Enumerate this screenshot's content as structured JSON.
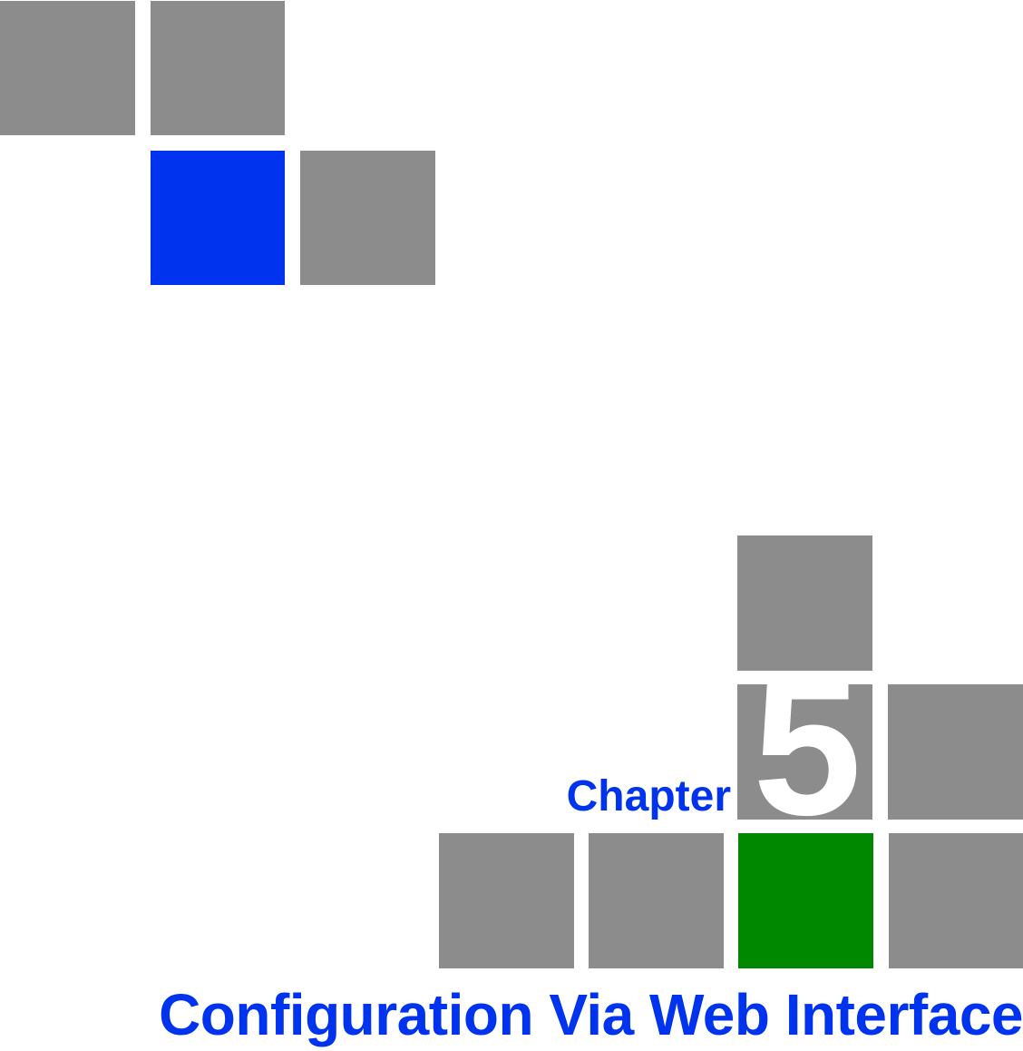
{
  "colors": {
    "block_grey": "#8c8c8c",
    "accent_blue": "#0033ee",
    "accent_green": "#008800",
    "background": "#ffffff"
  },
  "chapter": {
    "label": "Chapter",
    "number": "5"
  },
  "title": "Configuration Via Web Interface"
}
